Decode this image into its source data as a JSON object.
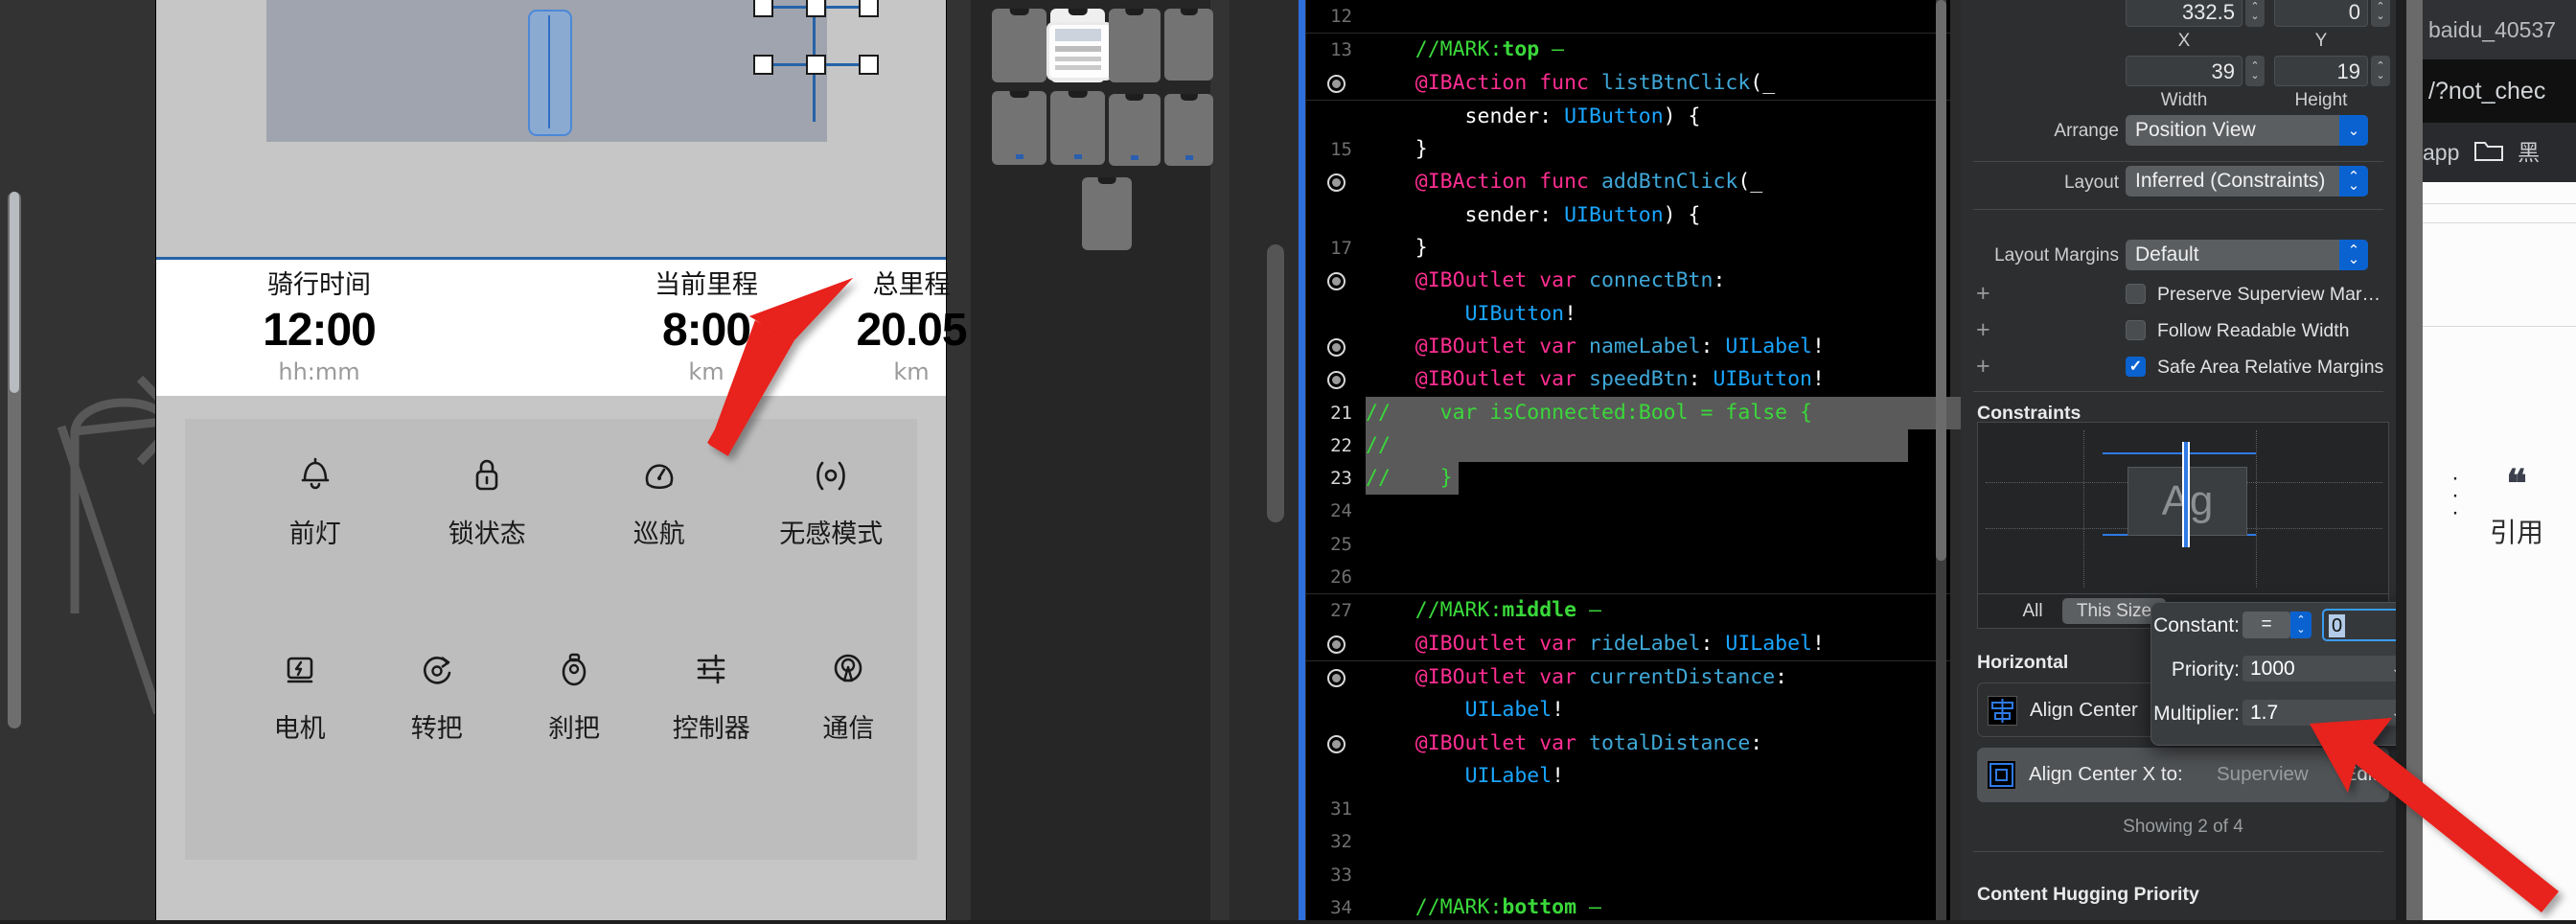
{
  "phone_preview": {
    "metrics": [
      {
        "label": "骑行时间",
        "value": "12:00",
        "unit": "hh:mm"
      },
      {
        "label": "当前里程",
        "value": "8:00",
        "unit": "km"
      },
      {
        "label": "总里程",
        "value": "20.05",
        "unit": "km"
      }
    ],
    "icons_row1": [
      {
        "name": "headlight-icon",
        "label": "前灯",
        "glyph": "bell"
      },
      {
        "name": "lock-icon",
        "label": "锁状态",
        "glyph": "lock"
      },
      {
        "name": "cruise-icon",
        "label": "巡航",
        "glyph": "gauge"
      },
      {
        "name": "sensorless-icon",
        "label": "无感模式",
        "glyph": "sensor"
      }
    ],
    "icons_row2": [
      {
        "name": "motor-icon",
        "label": "电机",
        "glyph": "motor"
      },
      {
        "name": "throttle-icon",
        "label": "转把",
        "glyph": "throttle"
      },
      {
        "name": "brake-icon",
        "label": "刹把",
        "glyph": "brake"
      },
      {
        "name": "controller-icon",
        "label": "控制器",
        "glyph": "sliders"
      },
      {
        "name": "comms-icon",
        "label": "通信",
        "glyph": "antenna"
      }
    ]
  },
  "editor": {
    "lines": [
      {
        "num": "12",
        "bp": false,
        "tokens": []
      },
      {
        "num": "13",
        "bp": false,
        "mark": true,
        "tokens": [
          {
            "t": "    //MARK:",
            "c": "cmt"
          },
          {
            "t": "top",
            "c": "cmtb"
          },
          {
            "t": " –",
            "c": "cmt"
          }
        ]
      },
      {
        "num": "",
        "bp": true,
        "markend": true,
        "tokens": [
          {
            "t": "    ",
            "c": "plain"
          },
          {
            "t": "@IBAction func ",
            "c": "kw"
          },
          {
            "t": "listBtnClick",
            "c": "fn"
          },
          {
            "t": "(_",
            "c": "plain"
          }
        ]
      },
      {
        "num": "",
        "bp": false,
        "tokens": [
          {
            "t": "        sender: ",
            "c": "plain"
          },
          {
            "t": "UIButton",
            "c": "type"
          },
          {
            "t": ") {",
            "c": "plain"
          }
        ]
      },
      {
        "num": "15",
        "bp": false,
        "tokens": [
          {
            "t": "    }",
            "c": "plain"
          }
        ]
      },
      {
        "num": "",
        "bp": true,
        "tokens": [
          {
            "t": "    ",
            "c": "plain"
          },
          {
            "t": "@IBAction func ",
            "c": "kw"
          },
          {
            "t": "addBtnClick",
            "c": "fn"
          },
          {
            "t": "(_",
            "c": "plain"
          }
        ]
      },
      {
        "num": "",
        "bp": false,
        "tokens": [
          {
            "t": "        sender: ",
            "c": "plain"
          },
          {
            "t": "UIButton",
            "c": "type"
          },
          {
            "t": ") {",
            "c": "plain"
          }
        ]
      },
      {
        "num": "17",
        "bp": false,
        "tokens": [
          {
            "t": "    }",
            "c": "plain"
          }
        ]
      },
      {
        "num": "",
        "bp": true,
        "tokens": [
          {
            "t": "    ",
            "c": "plain"
          },
          {
            "t": "@IBOutlet var ",
            "c": "kw"
          },
          {
            "t": "connectBtn",
            "c": "fn"
          },
          {
            "t": ":",
            "c": "plain"
          }
        ]
      },
      {
        "num": "",
        "bp": false,
        "tokens": [
          {
            "t": "        ",
            "c": "plain"
          },
          {
            "t": "UIButton",
            "c": "type"
          },
          {
            "t": "!",
            "c": "plain"
          }
        ]
      },
      {
        "num": "",
        "bp": true,
        "tokens": [
          {
            "t": "    ",
            "c": "plain"
          },
          {
            "t": "@IBOutlet var ",
            "c": "kw"
          },
          {
            "t": "nameLabel",
            "c": "fn"
          },
          {
            "t": ": ",
            "c": "plain"
          },
          {
            "t": "UILabel",
            "c": "type"
          },
          {
            "t": "!",
            "c": "plain"
          }
        ]
      },
      {
        "num": "",
        "bp": true,
        "tokens": [
          {
            "t": "    ",
            "c": "plain"
          },
          {
            "t": "@IBOutlet var ",
            "c": "kw"
          },
          {
            "t": "speedBtn",
            "c": "fn"
          },
          {
            "t": ": ",
            "c": "plain"
          },
          {
            "t": "UIButton",
            "c": "type"
          },
          {
            "t": "!",
            "c": "plain"
          }
        ]
      },
      {
        "num": "21",
        "bold": true,
        "bp": false,
        "hl": true,
        "tokens": [
          {
            "t": "//    var isConnected:Bool = false {",
            "c": "cmt"
          }
        ]
      },
      {
        "num": "22",
        "bold": true,
        "bp": false,
        "hl": true,
        "tokens": [
          {
            "t": "//",
            "c": "cmt"
          }
        ]
      },
      {
        "num": "23",
        "bold": true,
        "bp": false,
        "hl2": true,
        "tokens": [
          {
            "t": "//    }",
            "c": "cmt"
          }
        ]
      },
      {
        "num": "24",
        "bp": false,
        "tokens": []
      },
      {
        "num": "25",
        "bp": false,
        "tokens": []
      },
      {
        "num": "26",
        "bp": false,
        "tokens": []
      },
      {
        "num": "27",
        "bp": false,
        "mark": true,
        "tokens": [
          {
            "t": "    //MARK:",
            "c": "cmt"
          },
          {
            "t": "middle",
            "c": "cmtb"
          },
          {
            "t": " –",
            "c": "cmt"
          }
        ]
      },
      {
        "num": "",
        "bp": true,
        "markend": true,
        "tokens": [
          {
            "t": "    ",
            "c": "plain"
          },
          {
            "t": "@IBOutlet var ",
            "c": "kw"
          },
          {
            "t": "rideLabel",
            "c": "fn"
          },
          {
            "t": ": ",
            "c": "plain"
          },
          {
            "t": "UILabel",
            "c": "type"
          },
          {
            "t": "!",
            "c": "plain"
          }
        ]
      },
      {
        "num": "",
        "bp": true,
        "tokens": [
          {
            "t": "    ",
            "c": "plain"
          },
          {
            "t": "@IBOutlet var ",
            "c": "kw"
          },
          {
            "t": "currentDistance",
            "c": "fn"
          },
          {
            "t": ":",
            "c": "plain"
          }
        ]
      },
      {
        "num": "",
        "bp": false,
        "tokens": [
          {
            "t": "        ",
            "c": "plain"
          },
          {
            "t": "UILabel",
            "c": "type"
          },
          {
            "t": "!",
            "c": "plain"
          }
        ]
      },
      {
        "num": "",
        "bp": true,
        "tokens": [
          {
            "t": "    ",
            "c": "plain"
          },
          {
            "t": "@IBOutlet var ",
            "c": "kw"
          },
          {
            "t": "totalDistance",
            "c": "fn"
          },
          {
            "t": ":",
            "c": "plain"
          }
        ]
      },
      {
        "num": "",
        "bp": false,
        "tokens": [
          {
            "t": "        ",
            "c": "plain"
          },
          {
            "t": "UILabel",
            "c": "type"
          },
          {
            "t": "!",
            "c": "plain"
          }
        ]
      },
      {
        "num": "31",
        "bp": false,
        "tokens": []
      },
      {
        "num": "32",
        "bp": false,
        "tokens": []
      },
      {
        "num": "33",
        "bp": false,
        "tokens": []
      },
      {
        "num": "34",
        "bp": false,
        "tokens": [
          {
            "t": "    //MARK:",
            "c": "cmt"
          },
          {
            "t": "bottom",
            "c": "cmtb"
          },
          {
            "t": " –",
            "c": "cmt"
          }
        ]
      }
    ]
  },
  "inspector": {
    "x_value": "332.5",
    "y_value": "0",
    "x_caption": "X",
    "y_caption": "Y",
    "width_value": "39",
    "height_value": "19",
    "width_caption": "Width",
    "height_caption": "Height",
    "arrange_label": "Arrange",
    "arrange_value": "Position View",
    "layout_label": "Layout",
    "layout_value": "Inferred (Constraints)",
    "layout_margins_label": "Layout Margins",
    "layout_margins_value": "Default",
    "checkboxes": [
      {
        "label": "Preserve Superview Mar…",
        "checked": false
      },
      {
        "label": "Follow Readable Width",
        "checked": false
      },
      {
        "label": "Safe Area Relative Margins",
        "checked": true,
        "mark": "✓"
      }
    ],
    "constraints_title": "Constraints",
    "preview_text": "Ag",
    "seg_all": "All",
    "seg_this_size": "This Size",
    "horizontal_title": "Horizontal",
    "rows": [
      {
        "icon": "align-center-icon",
        "text": "Align Center",
        "value": "",
        "edit": "",
        "selected": false
      },
      {
        "icon": "align-center-x-icon",
        "text": "Align Center X to:",
        "value": "Superview",
        "edit": "Edit",
        "selected": true
      }
    ],
    "showing_text": "Showing 2 of 4",
    "content_hugging_title": "Content Hugging Priority"
  },
  "popover": {
    "constant_label": "Constant:",
    "relation": "=",
    "constant_value": "0",
    "priority_label": "Priority:",
    "priority_value": "1000",
    "multiplier_label": "Multiplier:",
    "multiplier_value": "1.7"
  },
  "browser": {
    "tab_title": "baidu_40537",
    "url": "/?not_chec",
    "bookmark": "app",
    "folder_icon": "folder-icon",
    "cn_text": "黑",
    "quote_mark": "❝",
    "quote_label": "引用"
  },
  "colors": {
    "accent_blue": "#0a62d0",
    "storyboard_blue": "#2563a8",
    "code_comment_green": "#3ad83a",
    "code_keyword_pink": "#ff2e92",
    "code_type_blue": "#1aa6ff",
    "annotation_red": "#e8201c"
  }
}
